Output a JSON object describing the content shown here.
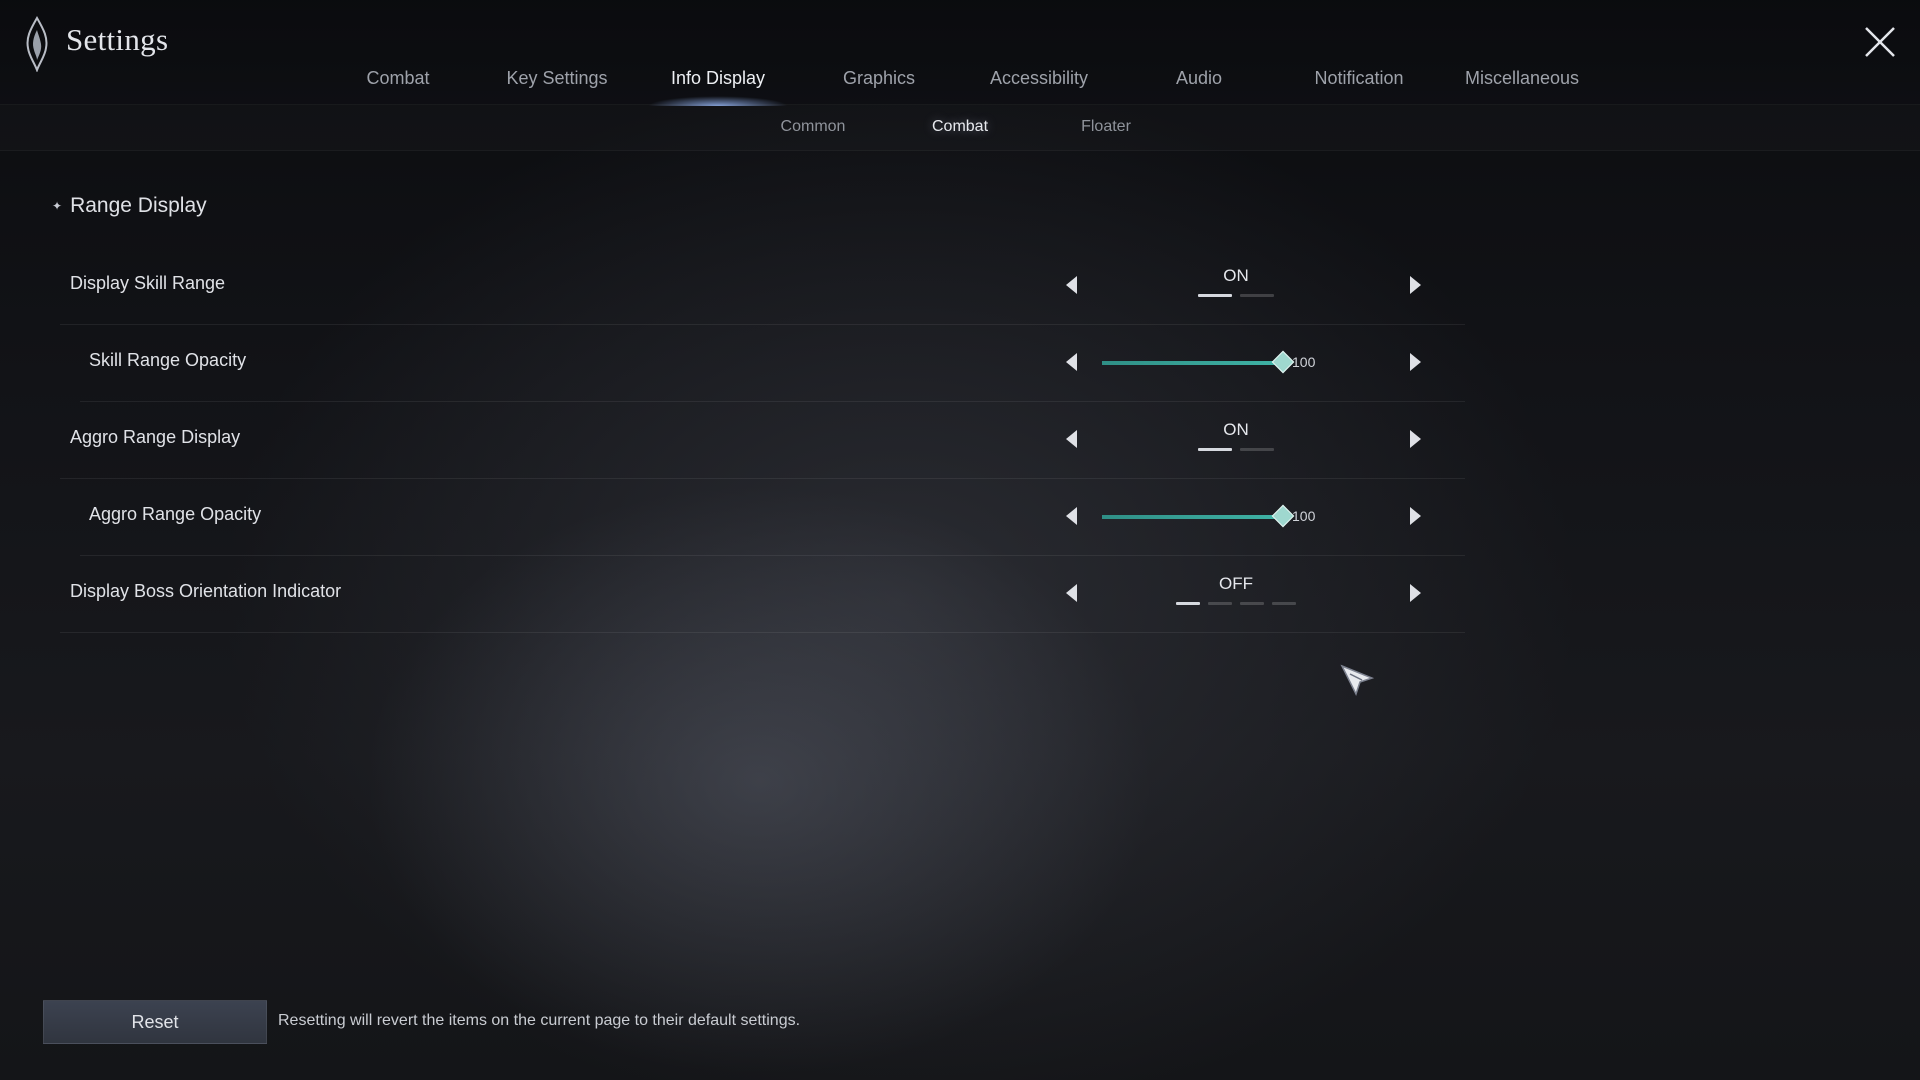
{
  "window": {
    "title": "Settings"
  },
  "tabs": [
    {
      "label": "Combat",
      "active": false
    },
    {
      "label": "Key Settings",
      "active": false
    },
    {
      "label": "Info Display",
      "active": true
    },
    {
      "label": "Graphics",
      "active": false
    },
    {
      "label": "Accessibility",
      "active": false
    },
    {
      "label": "Audio",
      "active": false
    },
    {
      "label": "Notification",
      "active": false
    },
    {
      "label": "Miscellaneous",
      "active": false
    }
  ],
  "subtabs": [
    {
      "label": "Common",
      "active": false
    },
    {
      "label": "Combat",
      "active": true
    },
    {
      "label": "Floater",
      "active": false
    }
  ],
  "section": {
    "title": "Range Display"
  },
  "settings": [
    {
      "label": "Display Skill Range",
      "type": "toggle",
      "value": "ON",
      "option_count": 2,
      "selected_index": 0
    },
    {
      "label": "Skill Range Opacity",
      "type": "slider",
      "value": "100",
      "percent": 100
    },
    {
      "label": "Aggro Range Display",
      "type": "toggle",
      "value": "ON",
      "option_count": 2,
      "selected_index": 0
    },
    {
      "label": "Aggro Range Opacity",
      "type": "slider",
      "value": "100",
      "percent": 100
    },
    {
      "label": "Display Boss Orientation Indicator",
      "type": "toggle",
      "value": "OFF",
      "option_count": 4,
      "selected_index": 0
    }
  ],
  "footer": {
    "reset_label": "Reset",
    "reset_note": "Resetting will revert the items on the current page to their default settings."
  },
  "icons": {
    "logo": "flame-crest-icon",
    "close": "close-icon",
    "prev": "chevron-left-icon",
    "next": "chevron-right-icon",
    "cursor": "mouse-pointer-icon"
  },
  "colors": {
    "accent": "#3fb3a6",
    "tab_indicator": "#8caae6"
  }
}
